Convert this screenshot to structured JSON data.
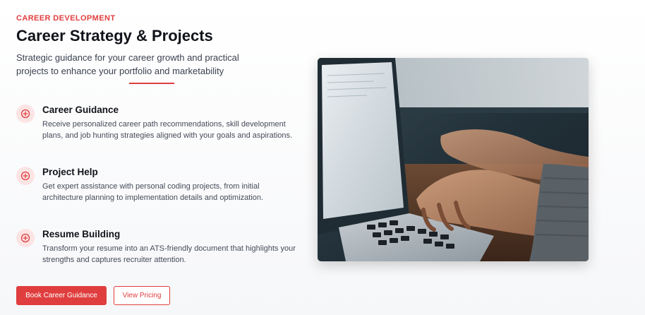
{
  "section": {
    "eyebrow": "CAREER DEVELOPMENT",
    "title": "Career Strategy & Projects",
    "subtitle": "Strategic guidance for your career growth and practical projects to enhance your portfolio and marketability"
  },
  "features": [
    {
      "icon": "plus-circle-icon",
      "title": "Career Guidance",
      "description": "Receive personalized career path recommendations, skill development plans, and job hunting strategies aligned with your goals and aspirations."
    },
    {
      "icon": "plus-circle-icon",
      "title": "Project Help",
      "description": "Get expert assistance with personal coding projects, from initial architecture planning to implementation details and optimization."
    },
    {
      "icon": "plus-circle-icon",
      "title": "Resume Building",
      "description": "Transform your resume into an ATS-friendly document that highlights your strengths and captures recruiter attention."
    }
  ],
  "actions": {
    "primary_label": "Book Career Guidance",
    "secondary_label": "View Pricing"
  },
  "colors": {
    "accent": "#e03e3e",
    "icon_bg": "#fde4e4",
    "heading": "#11131a",
    "body_text": "#454b59"
  },
  "image": {
    "subject": "hands-typing-on-laptop-photo"
  }
}
